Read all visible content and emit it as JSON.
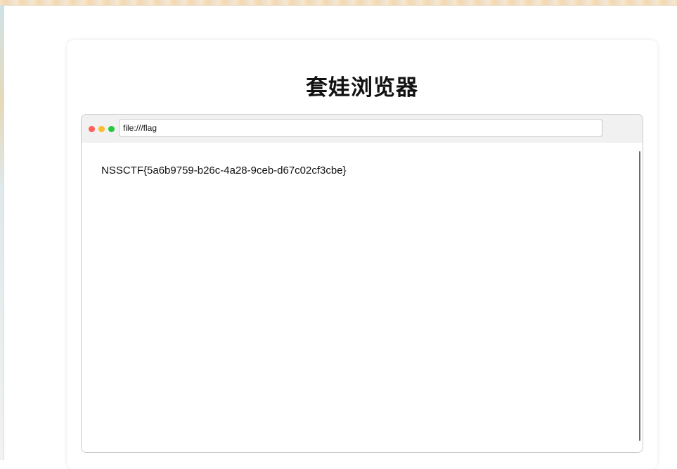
{
  "page": {
    "title": "套娃浏览器"
  },
  "browser": {
    "address": "file:///flag",
    "content_text": "NSSCTF{5a6b9759-b26c-4a28-9ceb-d67c02cf3cbe}"
  },
  "colors": {
    "close_dot": "#ff5f57",
    "minimize_dot": "#febc2e",
    "maximize_dot": "#28c840",
    "toolbar_bg": "#f1f1f1"
  }
}
